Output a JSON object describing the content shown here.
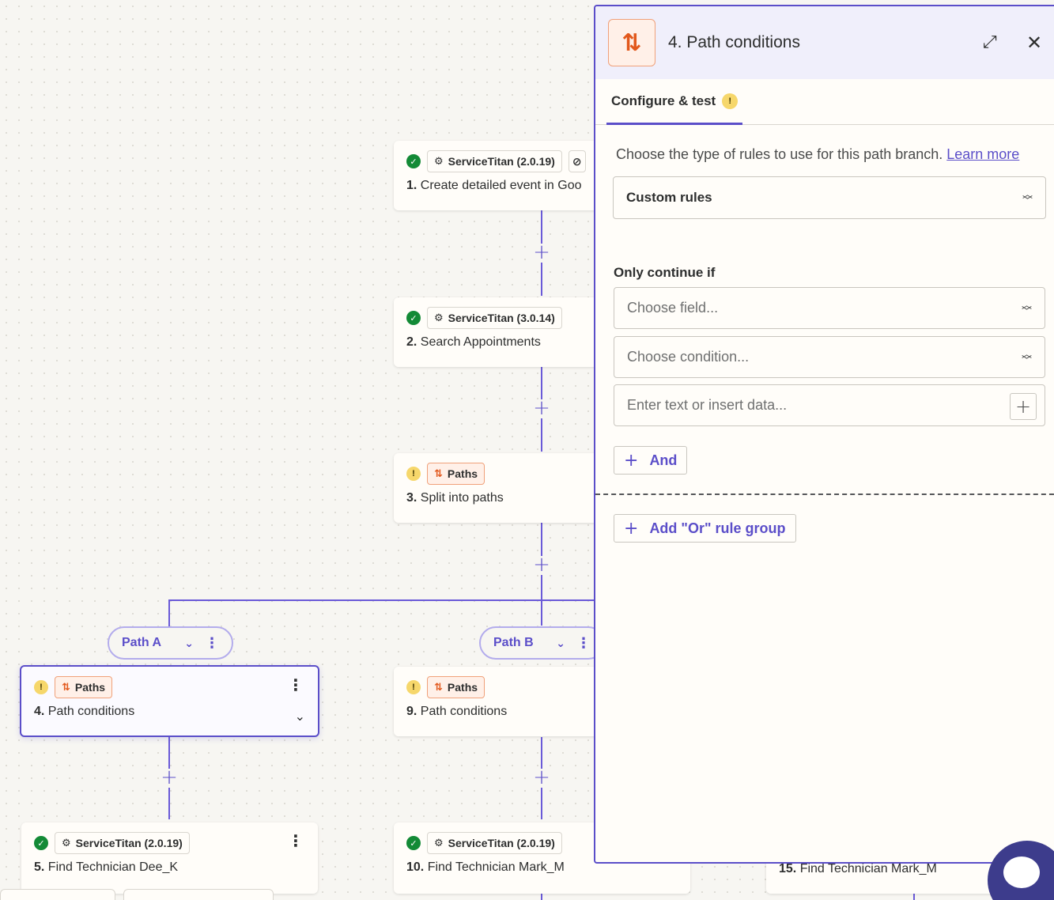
{
  "canvas": {
    "nodes": [
      {
        "id": "n1",
        "status": "ok",
        "app": "ServiceTitan (2.0.19)",
        "num": "1.",
        "title": "Create detailed event in Goo"
      },
      {
        "id": "n2",
        "status": "ok",
        "app": "ServiceTitan (3.0.14)",
        "num": "2.",
        "title": "Search Appointments"
      },
      {
        "id": "n3",
        "status": "warn",
        "app": "Paths",
        "num": "3.",
        "title": "Split into paths"
      },
      {
        "id": "n4",
        "status": "warn",
        "app": "Paths",
        "num": "4.",
        "title": "Path conditions"
      },
      {
        "id": "n9",
        "status": "warn",
        "app": "Paths",
        "num": "9.",
        "title": "Path conditions"
      },
      {
        "id": "n5",
        "status": "ok",
        "app": "ServiceTitan (2.0.19)",
        "num": "5.",
        "title": "Find Technician Dee_K"
      },
      {
        "id": "n10",
        "status": "ok",
        "app": "ServiceTitan (2.0.19)",
        "num": "10.",
        "title": "Find Technician Mark_M"
      },
      {
        "id": "n15",
        "num": "15.",
        "title": "Find Technician Mark_M"
      }
    ],
    "paths": [
      {
        "label": "Path A"
      },
      {
        "label": "Path B"
      }
    ]
  },
  "panel": {
    "title": "4. Path conditions",
    "tab_label": "Configure & test",
    "description": "Choose the type of rules to use for this path branch.",
    "learn_more": "Learn more",
    "rule_type": "Custom rules",
    "only_continue_if": "Only continue if",
    "field_placeholder": "Choose field...",
    "condition_placeholder": "Choose condition...",
    "value_placeholder": "Enter text or insert data...",
    "and_label": "And",
    "or_group_label": "Add \"Or\" rule group"
  },
  "icons": {
    "ok": "check-icon",
    "warn": "warning-icon",
    "expand": "expand-icon",
    "close": "close-icon",
    "chat": "chat-icon"
  },
  "colors": {
    "accent": "#5b4ec9",
    "paths_orange": "#e2581c",
    "success": "#138a36",
    "warning": "#f6d76b"
  }
}
